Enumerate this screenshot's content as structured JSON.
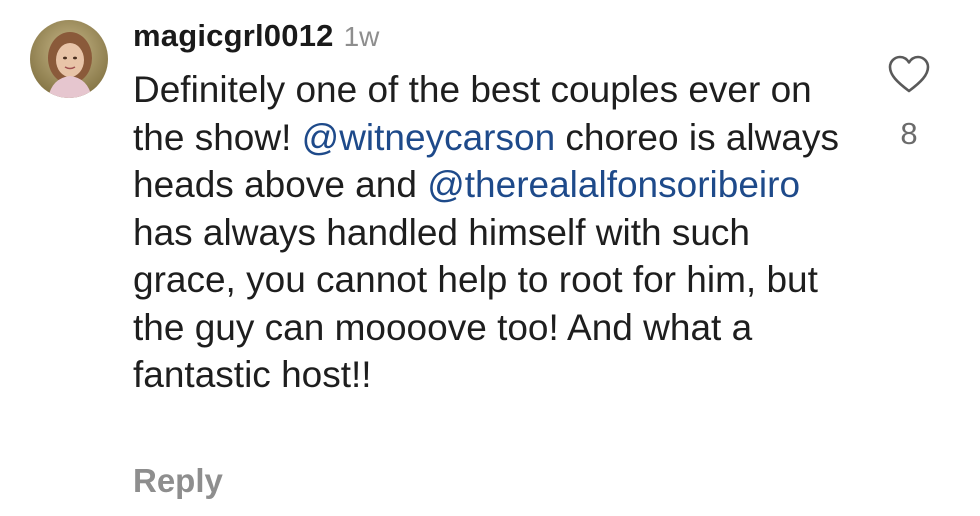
{
  "comment": {
    "username": "magicgrl0012",
    "time": "1w",
    "text_parts": [
      {
        "text": "Definitely one of the best couples ever on the show! ",
        "mention": false
      },
      {
        "text": "@witneycarson",
        "mention": true
      },
      {
        "text": " choreo is always heads above and ",
        "mention": false
      },
      {
        "text": "@therealalfonsoribeiro",
        "mention": true
      },
      {
        "text": " has always handled himself with such grace, you cannot help to root for him, but the guy can moooove too! And what a fantastic host!!",
        "mention": false
      }
    ],
    "reply_label": "Reply",
    "like_count": "8",
    "like_icon": "heart-outline-icon"
  },
  "colors": {
    "mention": "#1e4a8a",
    "muted": "#8e8e8e",
    "text": "#1e1e1e"
  }
}
